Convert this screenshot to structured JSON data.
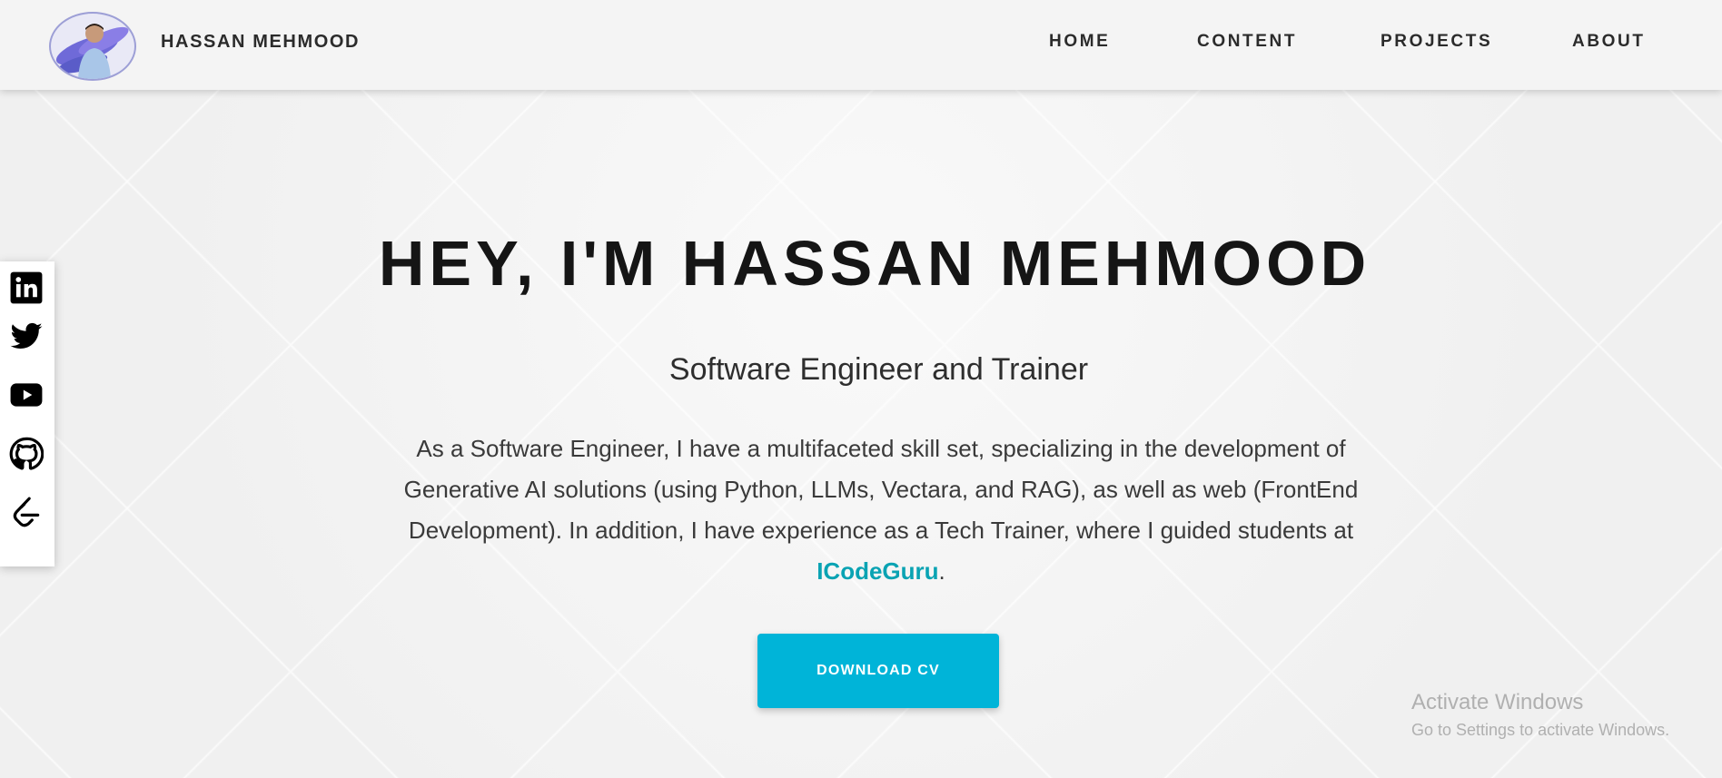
{
  "header": {
    "brand_name": "HASSAN MEHMOOD",
    "nav": [
      "HOME",
      "CONTENT",
      "PROJECTS",
      "ABOUT"
    ]
  },
  "social": [
    {
      "name": "linkedin",
      "icon": "linkedin-icon"
    },
    {
      "name": "twitter",
      "icon": "twitter-icon"
    },
    {
      "name": "youtube",
      "icon": "youtube-icon"
    },
    {
      "name": "github",
      "icon": "github-icon"
    },
    {
      "name": "leetcode",
      "icon": "leetcode-icon"
    }
  ],
  "hero": {
    "title": "HEY, I'M HASSAN MEHMOOD",
    "subtitle": "Software Engineer and Trainer",
    "description_text": "As a Software Engineer, I have a multifaceted skill set, specializing in the development of Generative AI solutions (using Python, LLMs, Vectara, and RAG), as well as web (FrontEnd Development). In addition, I have experience as a Tech Trainer, where I guided students at ",
    "description_link": "ICodeGuru",
    "description_end": ".",
    "cta_label": "DOWNLOAD CV"
  },
  "watermark": {
    "title": "Activate Windows",
    "subtitle": "Go to Settings to activate Windows."
  },
  "colors": {
    "accent": "#00b4d8",
    "link": "#0aa3b3",
    "text_dark": "#151515"
  }
}
